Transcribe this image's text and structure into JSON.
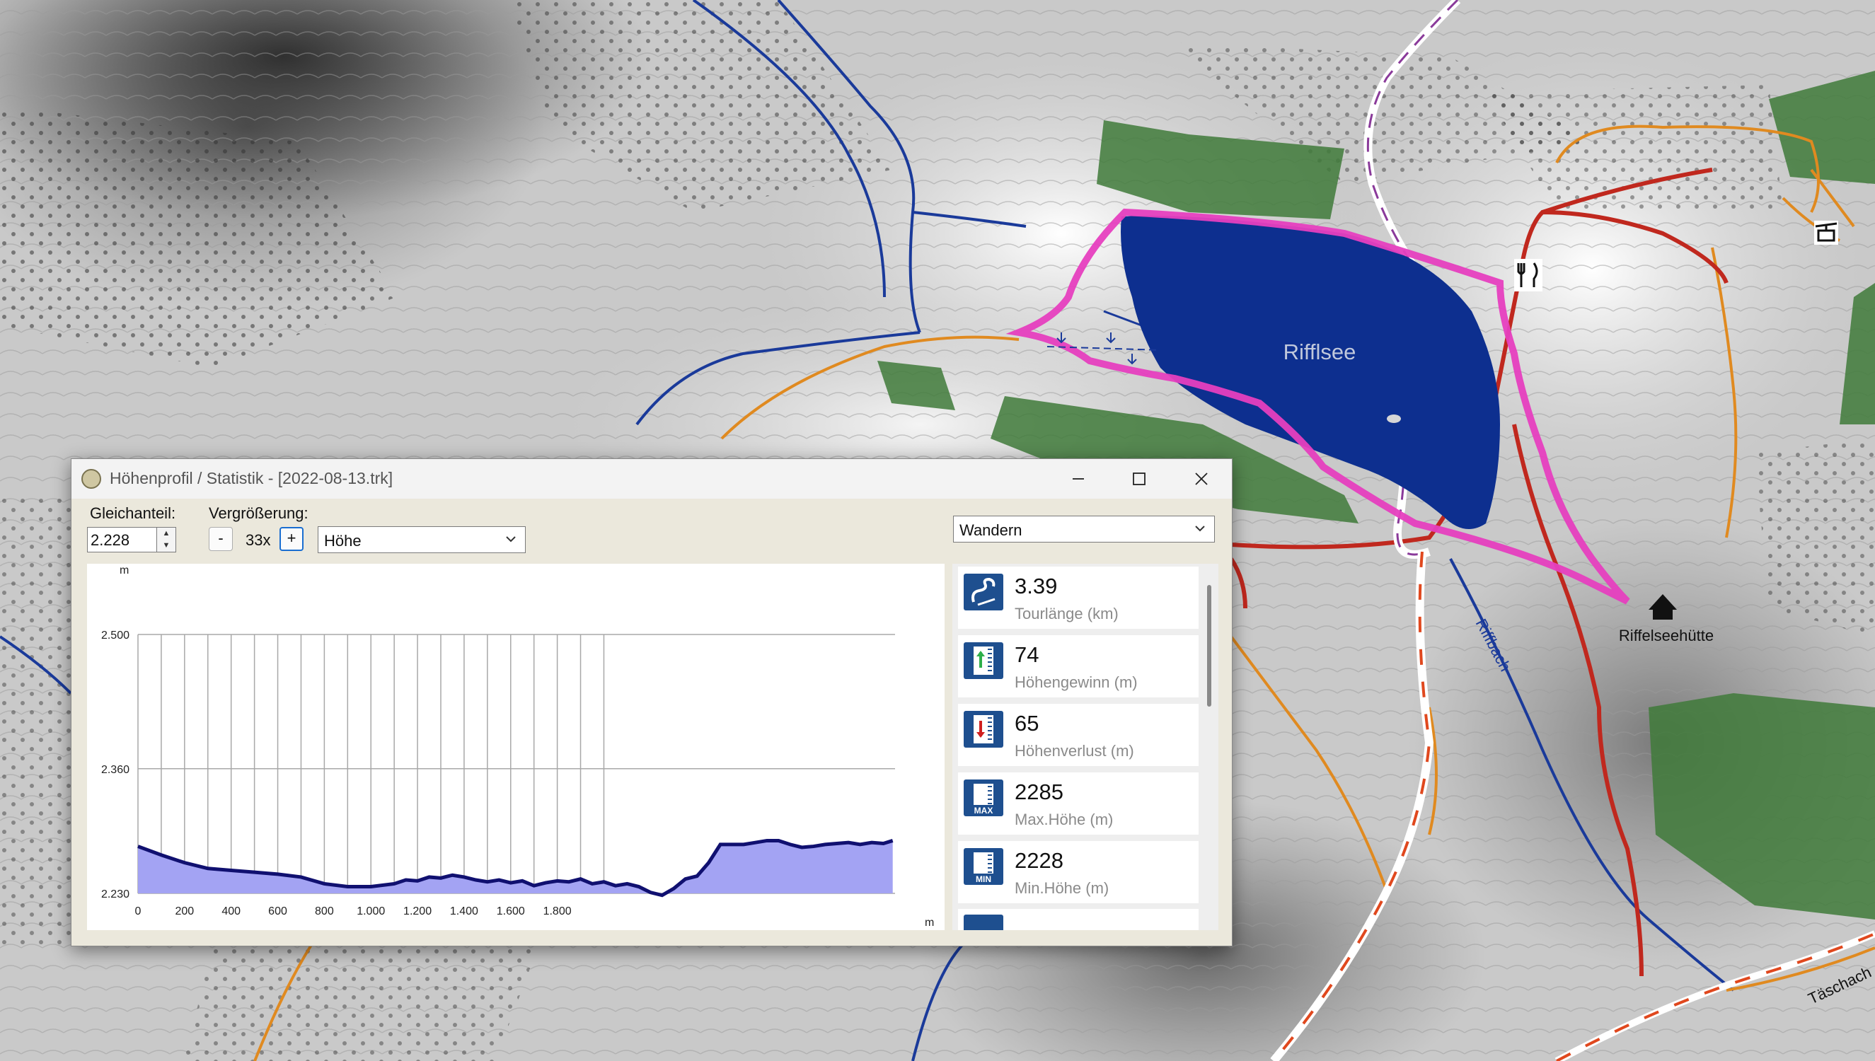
{
  "map": {
    "lake_label": "Rifflsee",
    "hut_label": "Riffelseehütte",
    "stream_label": "Riffbach",
    "corner_label": "Täschach"
  },
  "window": {
    "title": "Höhenprofil / Statistik - [2022-08-13.trk]",
    "gleichanteil_label": "Gleichanteil:",
    "gleichanteil_value": "2.228",
    "vergroesserung_label": "Vergrößerung:",
    "zoom_minus": "-",
    "zoom_value": "33x",
    "zoom_plus": "+",
    "profile_select": "Höhe",
    "activity_select": "Wandern"
  },
  "chart_data": {
    "type": "area",
    "x_unit": "m",
    "y_unit": "m",
    "y_ticks": [
      "2.500",
      "2.360",
      "2.230"
    ],
    "y_tick_values": [
      2500,
      2360,
      2230
    ],
    "x_ticks": [
      "0",
      "200",
      "400",
      "600",
      "800",
      "1.000",
      "1.200",
      "1.400",
      "1.600",
      "1.800"
    ],
    "x_tick_values": [
      0,
      200,
      400,
      600,
      800,
      1000,
      1200,
      1400,
      1600,
      1800
    ],
    "ylim": [
      2230,
      2500
    ],
    "xlim": [
      0,
      3250
    ],
    "series": [
      {
        "x": [
          0,
          100,
          200,
          300,
          400,
          500,
          600,
          700,
          800,
          900,
          1000,
          1100,
          1150,
          1200,
          1250,
          1300,
          1350,
          1400,
          1450,
          1500,
          1550,
          1600,
          1650,
          1700,
          1750,
          1800,
          1850,
          1900,
          1950,
          2000,
          2050,
          2100,
          2150,
          2200,
          2250,
          2300,
          2350,
          2400,
          2450,
          2500,
          2550,
          2600,
          2650,
          2700,
          2750,
          2800,
          2850,
          2900,
          2950,
          3000,
          3050,
          3100,
          3150,
          3200,
          3240
        ],
        "y": [
          2279,
          2270,
          2262,
          2256,
          2254,
          2252,
          2250,
          2247,
          2240,
          2237,
          2237,
          2240,
          2244,
          2243,
          2247,
          2246,
          2249,
          2247,
          2244,
          2242,
          2244,
          2241,
          2243,
          2238,
          2241,
          2243,
          2242,
          2245,
          2240,
          2242,
          2238,
          2240,
          2237,
          2231,
          2228,
          2235,
          2245,
          2248,
          2262,
          2281,
          2281,
          2281,
          2283,
          2285,
          2285,
          2281,
          2278,
          2279,
          2281,
          2282,
          2283,
          2281,
          2283,
          2282,
          2285
        ]
      }
    ],
    "colors": {
      "fill": "#a3a3f3",
      "line": "#101070",
      "grid": "#a8a8a8"
    },
    "grid": true
  },
  "stats": [
    {
      "value": "3.39",
      "label": "Tourlänge (km)",
      "icon": "track-length-icon"
    },
    {
      "value": "74",
      "label": "Höhengewinn (m)",
      "icon": "elevation-gain-icon"
    },
    {
      "value": "65",
      "label": "Höhenverlust (m)",
      "icon": "elevation-loss-icon"
    },
    {
      "value": "2285",
      "label": "Max.Höhe (m)",
      "icon": "max-elevation-icon",
      "badge": "MAX"
    },
    {
      "value": "2228",
      "label": "Min.Höhe (m)",
      "icon": "min-elevation-icon",
      "badge": "MIN"
    }
  ]
}
